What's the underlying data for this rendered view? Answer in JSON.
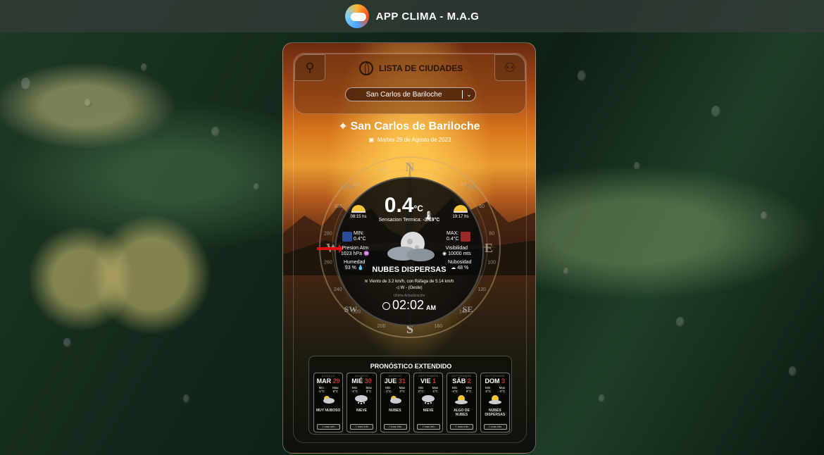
{
  "app": {
    "title": "APP CLIMA - M.A.G"
  },
  "city_panel": {
    "title": "LISTA DE CIUDADES",
    "selected_city": "San Carlos de Bariloche"
  },
  "location": {
    "city": "San Carlos de Bariloche",
    "date": "Martes 29 de Agosto de 2023"
  },
  "current": {
    "temp": "0.4",
    "unit": "°C",
    "feels_label": "Sensacion Termica:",
    "feels_value": "-3.19°C",
    "sunrise": "08:15 hs",
    "sunset": "19:17 hs",
    "min_label": "MIN:",
    "min_value": "0.4°C",
    "max_label": "MAX:",
    "max_value": "0.4°C",
    "pressure_label": "Presion Atm",
    "pressure_value": "1023 hPa",
    "visibility_label": "Visibilidad",
    "visibility_value": "10000 mts",
    "humidity_label": "Humedad",
    "humidity_value": "93 %",
    "cloudiness_label": "Nubosidad",
    "cloudiness_value": "48 %",
    "condition": "NUBES DISPERSAS",
    "wind": "Viento de 3.2 km/h, con Ráfaga de 5.14 km/h",
    "wind_dir": "W - (Oeste)",
    "updated_label": "Ultima Actualización",
    "time": "02:02",
    "ampm": "AM"
  },
  "compass": {
    "labels": {
      "n": "N",
      "s": "S",
      "e": "E",
      "w": "W",
      "ne": "NE",
      "se": "SE",
      "sw": "SW",
      "nw": "NW"
    },
    "degrees": [
      "300",
      "280",
      "260",
      "240",
      "220",
      "200",
      "160",
      "140",
      "120",
      "100",
      "80",
      "60",
      "40",
      "20",
      "340",
      "320"
    ]
  },
  "forecast": {
    "title": "PRONÓSTICO EXTENDIDO",
    "more_label": "mas info",
    "min_label": "Min",
    "max_label": "Max",
    "days": [
      {
        "month": "AGOSTO",
        "name": "MAR",
        "num": "29",
        "min": "-1°C",
        "max": "6°C",
        "desc": "MUY NUBOSO",
        "icon": "cloud-sun-icon"
      },
      {
        "month": "AGOSTO",
        "name": "MIÉ",
        "num": "30",
        "min": "-1°C",
        "max": "3°C",
        "desc": "NIEVE",
        "icon": "snow-cloud-icon"
      },
      {
        "month": "AGOSTO",
        "name": "JUE",
        "num": "31",
        "min": "-1°C",
        "max": "3°C",
        "desc": "NUBES",
        "icon": "cloud-sun-icon"
      },
      {
        "month": "SEPTIEMBRE",
        "name": "VIE",
        "num": "1",
        "min": "0°C",
        "max": "4°C",
        "desc": "NIEVE",
        "icon": "snow-cloud-icon"
      },
      {
        "month": "SEPTIEMBRE",
        "name": "SÁB",
        "num": "2",
        "min": "-4°C",
        "max": "8°C",
        "desc": "ALGO DE NUBES",
        "icon": "sun-cloud-icon"
      },
      {
        "month": "SEPTIEMBRE",
        "name": "DOM",
        "num": "3",
        "min": "-2°C",
        "max": "-2°C",
        "desc": "NUBES DISPERSAS",
        "icon": "sun-cloud-icon"
      }
    ]
  },
  "colors": {
    "accent_red": "#c0392b",
    "sun": "#f7c53a"
  }
}
